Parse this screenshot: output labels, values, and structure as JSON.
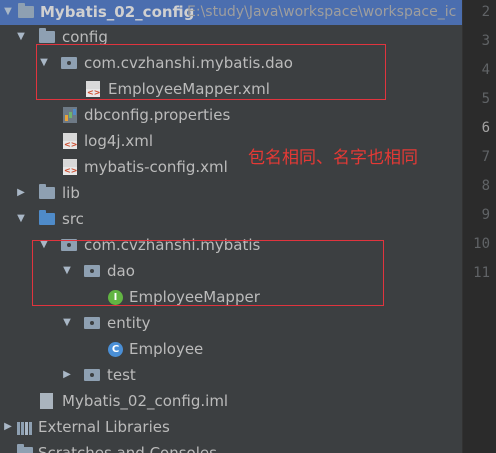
{
  "project": {
    "name": "Mybatis_02_config",
    "path": "E:\\study\\Java\\workspace\\workspace_ic"
  },
  "tree": {
    "config": "config",
    "config_package": "com.cvzhanshi.mybatis.dao",
    "employee_mapper_xml": "EmployeeMapper.xml",
    "dbconfig": "dbconfig.properties",
    "log4j": "log4j.xml",
    "mybatis_config": "mybatis-config.xml",
    "lib": "lib",
    "src": "src",
    "src_package": "com.cvzhanshi.mybatis",
    "dao": "dao",
    "employee_mapper": "EmployeeMapper",
    "entity": "entity",
    "employee": "Employee",
    "test": "test",
    "iml": "Mybatis_02_config.iml",
    "external_libraries": "External Libraries",
    "scratches": "Scratches and Consoles"
  },
  "icons": {
    "interface_letter": "I",
    "class_letter": "C"
  },
  "gutter": {
    "line_numbers": [
      "2",
      "3",
      "4",
      "5",
      "6",
      "7",
      "8",
      "9",
      "10",
      "11"
    ]
  },
  "annotation": "包名相同、名字也相同",
  "colors": {
    "annotation_red": "#e53935",
    "selection_blue": "#4b6eaf",
    "background": "#3c3f41"
  }
}
